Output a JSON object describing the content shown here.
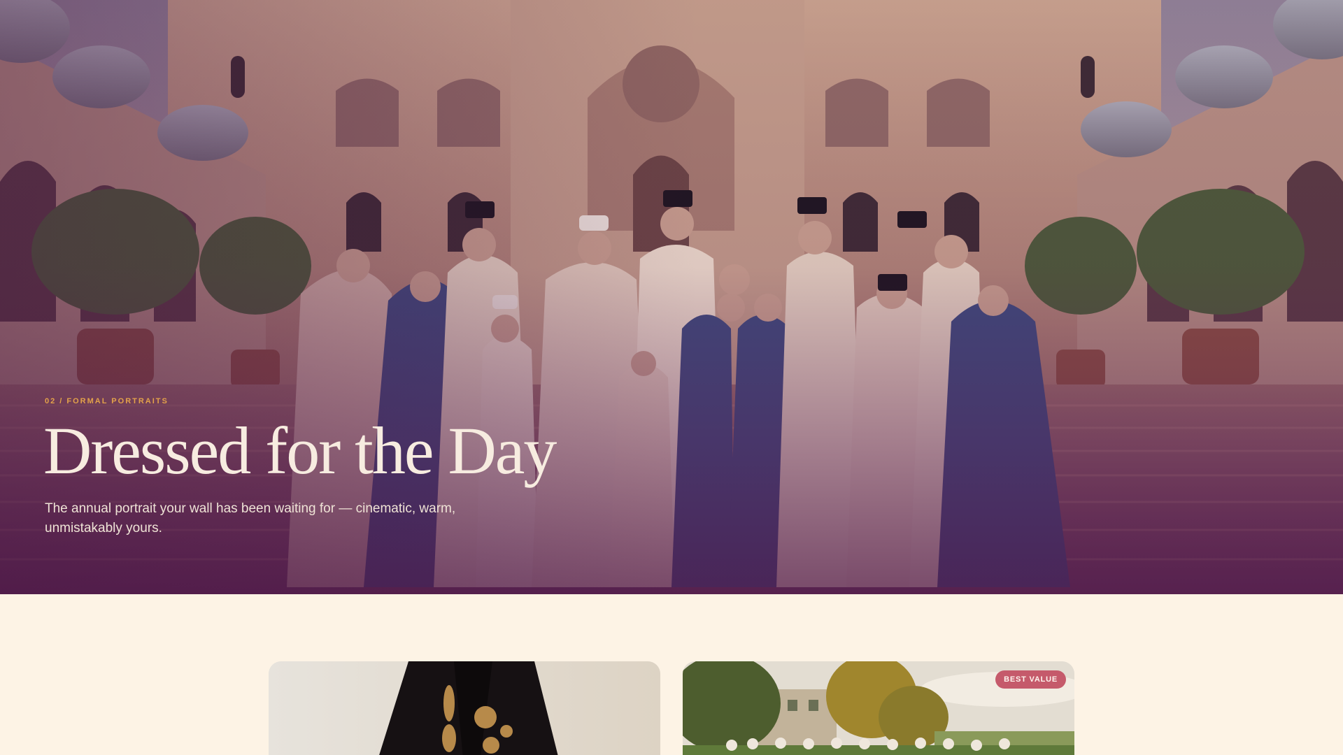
{
  "hero": {
    "eyebrow": "02 / FORMAL PORTRAITS",
    "title": "Dressed for the Day",
    "subtitle": "The annual portrait your wall has been waiting for — cinematic, warm, unmistakably yours."
  },
  "cards": [
    {
      "image": "black-embroidered-abaya-photo",
      "badge": ""
    },
    {
      "image": "family-group-outdoor-photo",
      "badge": "BEST VALUE"
    }
  ],
  "colors": {
    "background": "#fdf3e5",
    "eyebrow": "#e3a24a",
    "title": "#f7ece0",
    "badge": "#c55a6b"
  }
}
